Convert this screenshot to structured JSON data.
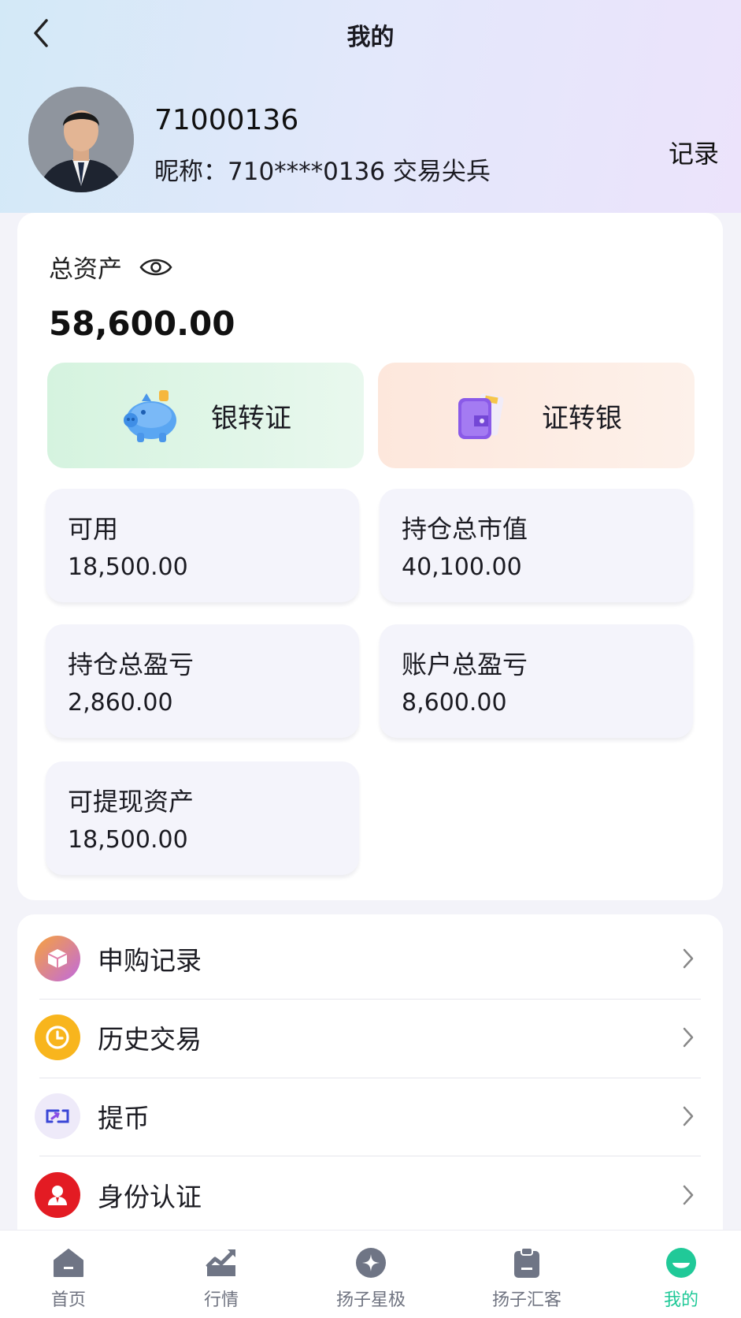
{
  "header": {
    "title": "我的",
    "user_id": "71000136",
    "nickname": "昵称：710****0136 交易尖兵",
    "record_label": "记录"
  },
  "assets": {
    "total_label": "总资产",
    "total_value": "58,600.00",
    "transfer_in_label": "银转证",
    "transfer_out_label": "证转银",
    "stats": [
      {
        "label": "可用",
        "value": "18,500.00"
      },
      {
        "label": "持仓总市值",
        "value": "40,100.00"
      },
      {
        "label": "持仓总盈亏",
        "value": "2,860.00"
      },
      {
        "label": "账户总盈亏",
        "value": "8,600.00"
      },
      {
        "label": "可提现资产",
        "value": "18,500.00"
      }
    ]
  },
  "menu": {
    "items": [
      {
        "label": "申购记录",
        "icon": "box-icon"
      },
      {
        "label": "历史交易",
        "icon": "clock-icon"
      },
      {
        "label": "提币",
        "icon": "withdraw-icon"
      },
      {
        "label": "身份认证",
        "icon": "user-icon"
      }
    ]
  },
  "tabbar": {
    "items": [
      {
        "label": "首页",
        "icon": "home-icon"
      },
      {
        "label": "行情",
        "icon": "chart-icon"
      },
      {
        "label": "扬子星极",
        "icon": "star-icon"
      },
      {
        "label": "扬子汇客",
        "icon": "clipboard-icon"
      },
      {
        "label": "我的",
        "icon": "profile-icon"
      }
    ],
    "active_index": 4
  },
  "colors": {
    "accent_green": "#20c998",
    "tab_inactive": "#6f7380"
  }
}
